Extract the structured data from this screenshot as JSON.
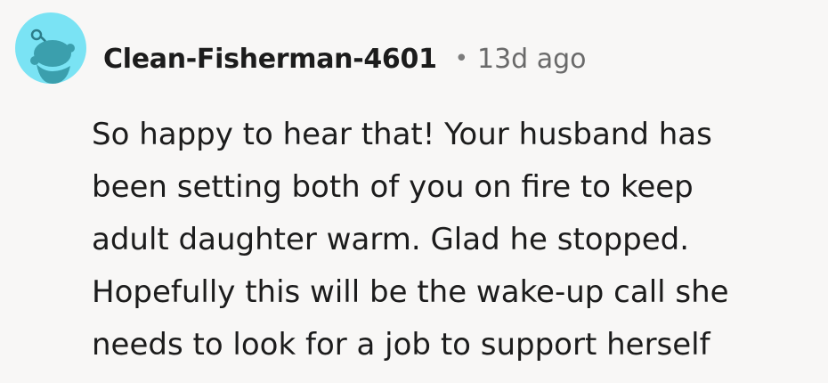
{
  "comment": {
    "author": "Clean-Fisherman-4601",
    "separator": "•",
    "age": "13d ago",
    "avatar_icon": "reddit-snoo-avatar-icon",
    "avatar_color": "#7ae3f4",
    "body_lines": [
      "So happy to hear that! Your husband has",
      "been setting both of you on fire to keep",
      "adult daughter warm. Glad he stopped.",
      "Hopefully this will be the wake-up call she",
      "needs to look for a job to support herself"
    ]
  }
}
